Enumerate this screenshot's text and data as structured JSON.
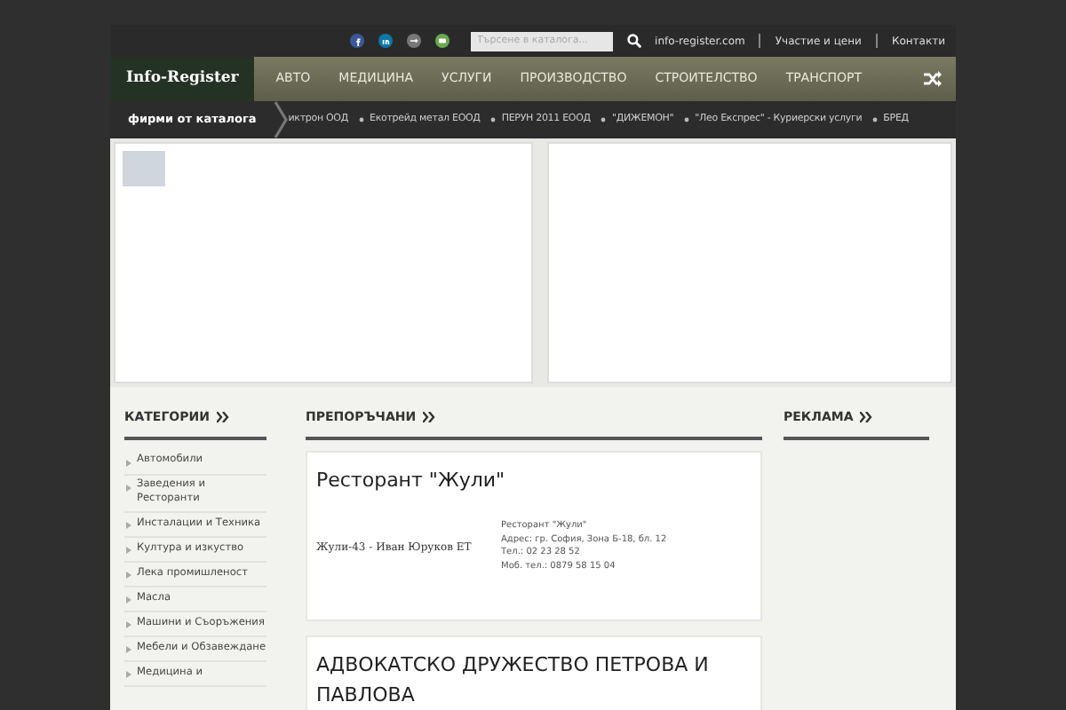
{
  "topbar": {
    "social": [
      {
        "kind": "facebook",
        "color": "#3b5998"
      },
      {
        "kind": "linkedin",
        "color": "#0e76a8"
      },
      {
        "kind": "googleplus",
        "color": "#777777"
      },
      {
        "kind": "rss",
        "color": "#6aa84f"
      }
    ],
    "search": {
      "placeholder": "Търсене в каталога..."
    },
    "links": [
      "info-register.com",
      "Участие и цени",
      "Контакти"
    ]
  },
  "nav": {
    "logo": "Info-Register",
    "items": [
      "АВТО",
      "МЕДИЦИНА",
      "УСЛУГИ",
      "ПРОИЗВОДСТВО",
      "СТРОИТЕЛСТВО",
      "ТРАНСПОРТ"
    ]
  },
  "ticker": {
    "label": "фирми от каталога",
    "items": [
      "иктрон ООД",
      "Екотрейд метал ЕООД",
      "ПЕРУН 2011 ЕООД",
      "\"ДИЖЕМОН\"",
      "\"Лео Експрес\" - Куриерски услуги",
      "БРЕД"
    ]
  },
  "categories": {
    "title": "КАТЕГОРИИ",
    "items": [
      "Автомобили",
      "Заведения и Ресторанти",
      "Инсталации и Техника",
      "Култура и изкуство",
      "Лека промишленост",
      "Масла",
      "Машини и Съоръжения",
      "Мебели и Обзавеждане",
      "Медицина и"
    ]
  },
  "recommended": {
    "title": "ПРЕПОРЪЧАНИ",
    "cards": [
      {
        "title": "Ресторант \"Жули\"",
        "logo_text": "Жули-43 - Иван Юруков ЕТ",
        "details": [
          "Ресторант \"Жули\"",
          "Адрес: гр. София, Зона Б-18, бл. 12",
          "Тел.: 02 23 28 52",
          "Моб. тел.: 0879 58 15 04"
        ]
      },
      {
        "title": "АДВОКАТСКО ДРУЖЕСТВО ПЕТРОВА И ПАВЛОВА"
      }
    ]
  },
  "ads": {
    "title": "РЕКЛАМА"
  }
}
